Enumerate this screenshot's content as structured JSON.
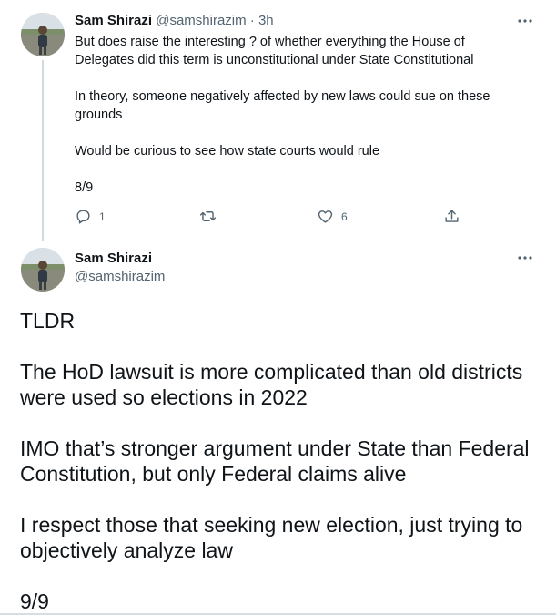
{
  "tweet1": {
    "author_name": "Sam Shirazi",
    "author_handle": "@samshirazim",
    "separator": "·",
    "time": "3h",
    "lines": [
      "But does raise the interesting ? of whether everything the House of",
      "Delegates did this term is unconstitutional under State Constitutional",
      "In theory, someone negatively affected by new laws could sue on these",
      "grounds",
      "Would be curious to see how state courts would rule",
      "8/9"
    ],
    "reply_count": "1",
    "like_count": "6",
    "icons": {
      "more": "more-horizontal-icon",
      "reply": "reply-icon",
      "retweet": "retweet-icon",
      "like": "heart-icon",
      "share": "share-icon"
    }
  },
  "tweet2": {
    "author_name": "Sam Shirazi",
    "author_handle": "@samshirazim",
    "lines": [
      "TLDR",
      "The HoD lawsuit is more complicated than old districts",
      "were used so elections in 2022",
      "IMO that’s stronger argument under State than Federal",
      "Constitution, but only Federal claims alive",
      "I respect those that seeking new election, just trying to",
      "objectively analyze law",
      "9/9"
    ]
  },
  "colors": {
    "text": "#0f1419",
    "secondary": "#536471",
    "thread_line": "#cfd9de"
  }
}
